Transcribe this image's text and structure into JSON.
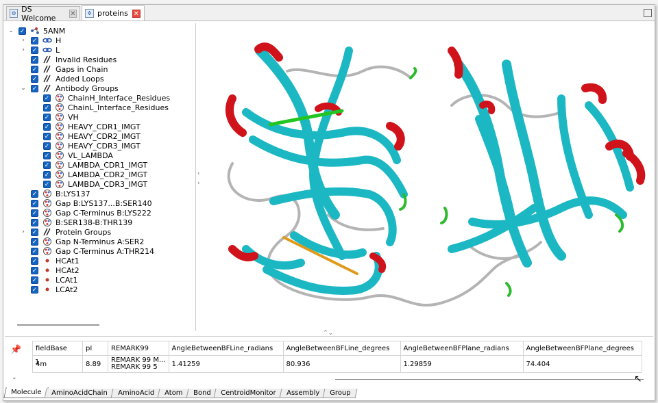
{
  "tabs": [
    {
      "label": "DS Welcome",
      "active": false
    },
    {
      "label": "proteins",
      "active": true
    }
  ],
  "tree": [
    {
      "label": "5ANM",
      "level": 0,
      "twisty": "expanded",
      "icon": "molecule-icon"
    },
    {
      "label": "H",
      "level": 1,
      "twisty": "collapsed",
      "icon": "chain-icon"
    },
    {
      "label": "L",
      "level": 1,
      "twisty": "collapsed",
      "icon": "chain-icon"
    },
    {
      "label": "Invalid Residues",
      "level": 1,
      "twisty": "none",
      "icon": "hatch-icon"
    },
    {
      "label": "Gaps in Chain",
      "level": 1,
      "twisty": "none",
      "icon": "hatch-icon"
    },
    {
      "label": "Added Loops",
      "level": 1,
      "twisty": "none",
      "icon": "hatch-icon"
    },
    {
      "label": "Antibody Groups",
      "level": 1,
      "twisty": "expanded",
      "icon": "hatch-icon"
    },
    {
      "label": "ChainH_Interface_Residues",
      "level": 2,
      "twisty": "none",
      "icon": "group-icon"
    },
    {
      "label": "ChainL_Interface_Residues",
      "level": 2,
      "twisty": "none",
      "icon": "group-icon"
    },
    {
      "label": "VH",
      "level": 2,
      "twisty": "none",
      "icon": "group-icon"
    },
    {
      "label": "HEAVY_CDR1_IMGT",
      "level": 2,
      "twisty": "none",
      "icon": "group-icon"
    },
    {
      "label": "HEAVY_CDR2_IMGT",
      "level": 2,
      "twisty": "none",
      "icon": "group-icon"
    },
    {
      "label": "HEAVY_CDR3_IMGT",
      "level": 2,
      "twisty": "none",
      "icon": "group-icon"
    },
    {
      "label": "VL_LAMBDA",
      "level": 2,
      "twisty": "none",
      "icon": "group-icon"
    },
    {
      "label": "LAMBDA_CDR1_IMGT",
      "level": 2,
      "twisty": "none",
      "icon": "group-icon"
    },
    {
      "label": "LAMBDA_CDR2_IMGT",
      "level": 2,
      "twisty": "none",
      "icon": "group-icon"
    },
    {
      "label": "LAMBDA_CDR3_IMGT",
      "level": 2,
      "twisty": "none",
      "icon": "group-icon"
    },
    {
      "label": "B:LYS137",
      "level": 1,
      "twisty": "none",
      "icon": "group-icon"
    },
    {
      "label": "Gap B:LYS137...B:SER140",
      "level": 1,
      "twisty": "none",
      "icon": "group-icon"
    },
    {
      "label": "Gap C-Terminus B:LYS222",
      "level": 1,
      "twisty": "none",
      "icon": "group-icon"
    },
    {
      "label": "B:SER138-B:THR139",
      "level": 1,
      "twisty": "none",
      "icon": "group-icon"
    },
    {
      "label": "Protein Groups",
      "level": 1,
      "twisty": "collapsed",
      "icon": "hatch-icon"
    },
    {
      "label": "Gap N-Terminus A:SER2",
      "level": 1,
      "twisty": "none",
      "icon": "group-icon"
    },
    {
      "label": "Gap C-Terminus A:THR214",
      "level": 1,
      "twisty": "none",
      "icon": "group-icon"
    },
    {
      "label": "HCAt1",
      "level": 1,
      "twisty": "none",
      "icon": "atom-icon"
    },
    {
      "label": "HCAt2",
      "level": 1,
      "twisty": "none",
      "icon": "atom-icon"
    },
    {
      "label": "LCAt1",
      "level": 1,
      "twisty": "none",
      "icon": "atom-icon"
    },
    {
      "label": "LCAt2",
      "level": 1,
      "twisty": "none",
      "icon": "atom-icon"
    }
  ],
  "table": {
    "headers": [
      "fieldBase",
      "pI",
      "REMARK99",
      "AngleBetweenBFLine_radians",
      "AngleBetweenBFLine_degrees",
      "AngleBetweenBFPlane_radians",
      "AngleBetweenBFPlane_degrees"
    ],
    "row_number": "1",
    "row": [
      "4m",
      "8.89",
      "REMARK 99 M...",
      "1.41259",
      "80.936",
      "1.29859",
      "74.404"
    ],
    "remark_line2": "REMARK 99 5"
  },
  "bottom_tabs": [
    "Molecule",
    "AminoAcidChain",
    "AminoAcid",
    "Atom",
    "Bond",
    "CentroidMonitor",
    "Assembly",
    "Group"
  ],
  "colors": {
    "helix": "#d0121b",
    "sheet": "#1bb8c4",
    "coil": "#b4b4b4",
    "turn": "#2dbb2d",
    "line_green": "#22c522",
    "line_orange": "#e09a1a",
    "checkbox": "#1565c0"
  }
}
